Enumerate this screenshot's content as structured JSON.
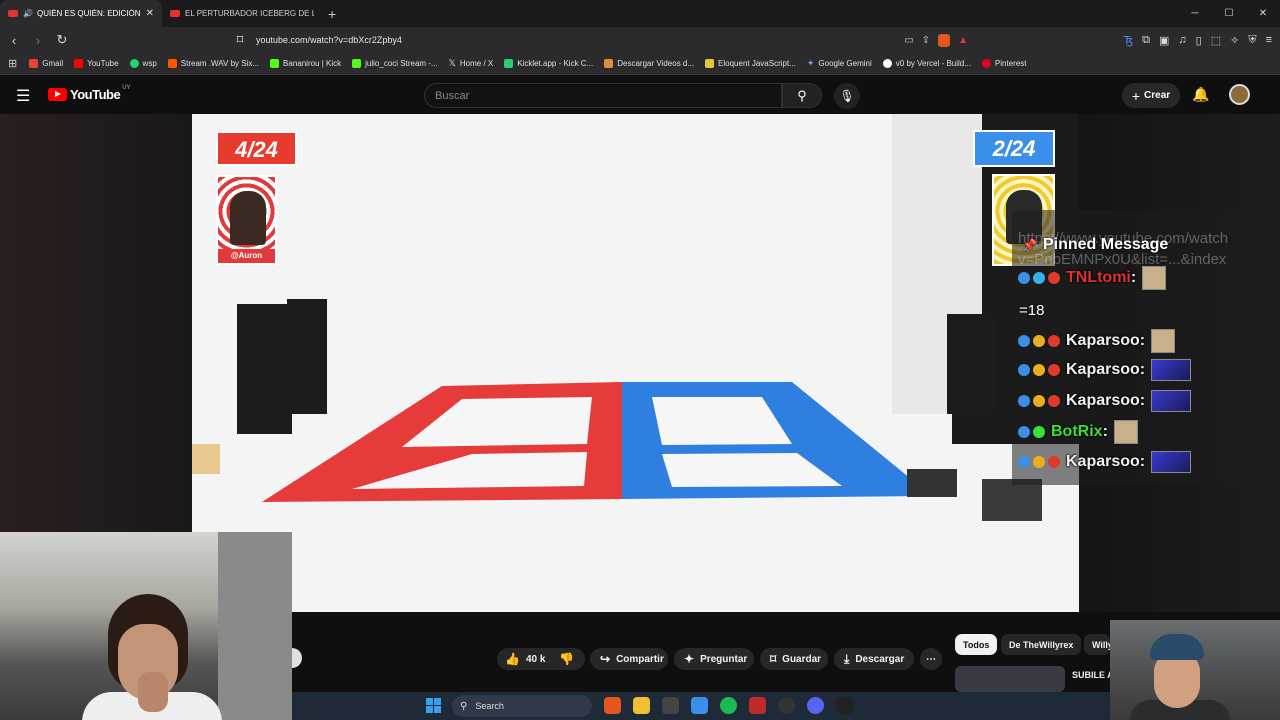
{
  "browser": {
    "tabs": [
      {
        "label": "QUIÉN ES QUIÉN: EDICIÓN F",
        "active": true
      },
      {
        "label": "EL PERTURBADOR ICEBERG DE LOS J",
        "active": false
      }
    ],
    "url": "youtube.com/watch?v=dbXcr2Zpby4",
    "bookmarks": [
      {
        "label": "Gmail",
        "color": "#ea4335"
      },
      {
        "label": "YouTube",
        "color": "#ff0000"
      },
      {
        "label": "wsp",
        "color": "#25d366"
      },
      {
        "label": "Stream .WAV by Six...",
        "color": "#ff5500"
      },
      {
        "label": "Bananirou | Kick",
        "color": "#53fc18"
      },
      {
        "label": "julio_coci Stream -...",
        "color": "#53fc18"
      },
      {
        "label": "Home / X",
        "color": "#ffffff"
      },
      {
        "label": "Kicklet.app - Kick C...",
        "color": "#2ecc71"
      },
      {
        "label": "Descargar Videos d...",
        "color": "#e88a3a"
      },
      {
        "label": "Eloquent JavaScript...",
        "color": "#e8c53a"
      },
      {
        "label": "Google Gemini",
        "color": "#7a9cf0"
      },
      {
        "label": "v0 by Vercel - Build...",
        "color": "#ffffff"
      },
      {
        "label": "Pinterest",
        "color": "#e60023"
      }
    ]
  },
  "youtube": {
    "logo_text": "YouTube",
    "country_code": "UY",
    "search_placeholder": "Buscar",
    "create_label": "Crear"
  },
  "video": {
    "score_left": "4/24",
    "score_right": "2/24",
    "handle_left": "@Auron",
    "chat": {
      "pinned_title": "Pinned Message",
      "ghost_url_line1": "https://www.youtube.com/watch",
      "ghost_url_line2": "v=PnbEMNPx0U&list=...&index",
      "count": "=18",
      "messages": [
        {
          "user": "TNLtomi",
          "color": "#e03030",
          "emote": "face"
        },
        {
          "user": "Kaparsoo",
          "color": "#f0f0f0",
          "emote": "face"
        },
        {
          "user": "Kaparsoo",
          "color": "#f0f0f0",
          "emote": "blue"
        },
        {
          "user": "Kaparsoo",
          "color": "#f0f0f0",
          "emote": "blue"
        },
        {
          "user": "BotRix",
          "color": "#3ae03a",
          "emote": "face"
        },
        {
          "user": "Kaparsoo",
          "color": "#f0f0f0",
          "emote": "blue"
        }
      ]
    }
  },
  "actions": {
    "likes": "40 k",
    "share": "Compartir",
    "ask": "Preguntar",
    "save": "Guardar",
    "download": "Descargar"
  },
  "sidebar": {
    "chips": [
      "Todos",
      "De TheWillyrex",
      "Willy"
    ],
    "rec_title": "SUBILE A"
  },
  "taskbar": {
    "search": "Search"
  }
}
